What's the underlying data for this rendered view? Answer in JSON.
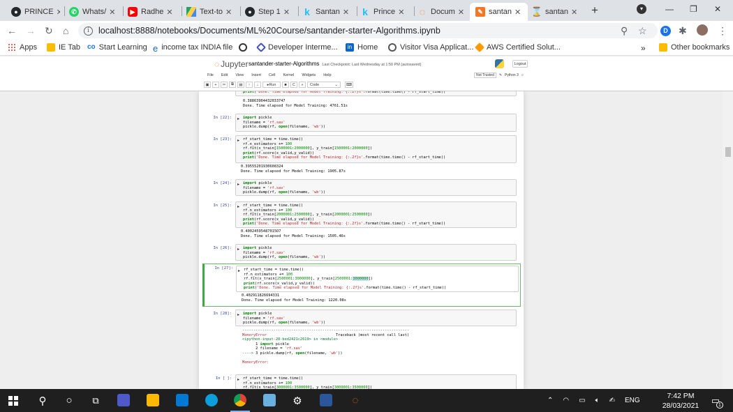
{
  "browser": {
    "tabs": [
      {
        "label": "PRINCE",
        "icon": "github-icon",
        "color": "#24292e"
      },
      {
        "label": "Whats/",
        "icon": "whatsapp-icon",
        "color": "#25d366"
      },
      {
        "label": "Radhe",
        "icon": "youtube-icon",
        "color": "#ff0000"
      },
      {
        "label": "Text-to",
        "icon": "google-drive-icon",
        "color": "#1fa463"
      },
      {
        "label": "Step 1",
        "icon": "github-icon",
        "color": "#24292e"
      },
      {
        "label": "Santan",
        "icon": "kaggle-icon",
        "color": "#20beff"
      },
      {
        "label": "Prince",
        "icon": "kaggle-icon",
        "color": "#20beff"
      },
      {
        "label": "Docum",
        "icon": "jupyter-icon",
        "color": "#f37726"
      },
      {
        "label": "santan",
        "icon": "jupyter-edit-icon",
        "color": "#f37726"
      },
      {
        "label": "santan",
        "icon": "jupyter-hourglass-icon",
        "color": "#f37726"
      }
    ],
    "url": "localhost:8888/notebooks/Documents/ML%20Course/santander-starter-Algorithms.ipynb",
    "bookmarks": [
      {
        "label": "Apps",
        "color": "#d93025"
      },
      {
        "label": "IE Tab",
        "color": "#fbbc04"
      },
      {
        "label": "Start Learning",
        "color": "#1a73e8"
      },
      {
        "label": "income tax INDIA file",
        "color": "#1565c0"
      },
      {
        "label": "",
        "color": "#333333"
      },
      {
        "label": "Developer Interme...",
        "color": "#3f51b5"
      },
      {
        "label": "Home",
        "color": "#0a66c2"
      },
      {
        "label": "Visitor Visa Applicat...",
        "color": "#555555"
      },
      {
        "label": "AWS Certified Solut...",
        "color": "#ff9900"
      }
    ],
    "more_bookmarks": "»",
    "other_bookmarks": "Other bookmarks"
  },
  "jupyter": {
    "logo": "Jupyter",
    "notebook_title": "santander-starter-Algorithms",
    "checkpoint": "Last Checkpoint: Last Wednesday at 1:50 PM  (autosaved)",
    "logout": "Logout",
    "menu": [
      "File",
      "Edit",
      "View",
      "Insert",
      "Cell",
      "Kernel",
      "Widgets",
      "Help"
    ],
    "trusted": "Not Trusted",
    "kernel": "Python 3",
    "run_label": "Run",
    "cell_type": "Code"
  },
  "cells": {
    "c0": {
      "out1": "0.38863904432033747",
      "out2": "Done. Time elapsed for Model Training: 4761.51s"
    },
    "c22": {
      "prompt": "In [22]:"
    },
    "c23": {
      "prompt": "In [23]:",
      "out1": "0.39555201930608324",
      "out2": "Done. Time elapsed for Model Training: 1905.87s"
    },
    "c24": {
      "prompt": "In [24]:"
    },
    "c25": {
      "prompt": "In [25]:",
      "out1": "0.40024595487015O7",
      "out2": "Done. Time elapsed for Model Training: 1505.46s"
    },
    "c26": {
      "prompt": "In [26]:"
    },
    "c27": {
      "prompt": "In [27]:",
      "out1": "0.402911826694331",
      "out2": "Done. Time elapsed for Model Training: 1220.08s"
    },
    "c28": {
      "prompt": "In [28]:",
      "err_name": "MemoryError",
      "traceback": "Traceback (most recent call last)",
      "err_loc": "<ipython-input-28-bed2421c2619> in <module>",
      "final": "MemoryError:"
    },
    "c29": {
      "prompt": "In [ ]:"
    }
  },
  "taskbar": {
    "lang": "ENG",
    "time": "7:42 PM",
    "date": "28/03/2021",
    "notif_count": "1"
  }
}
